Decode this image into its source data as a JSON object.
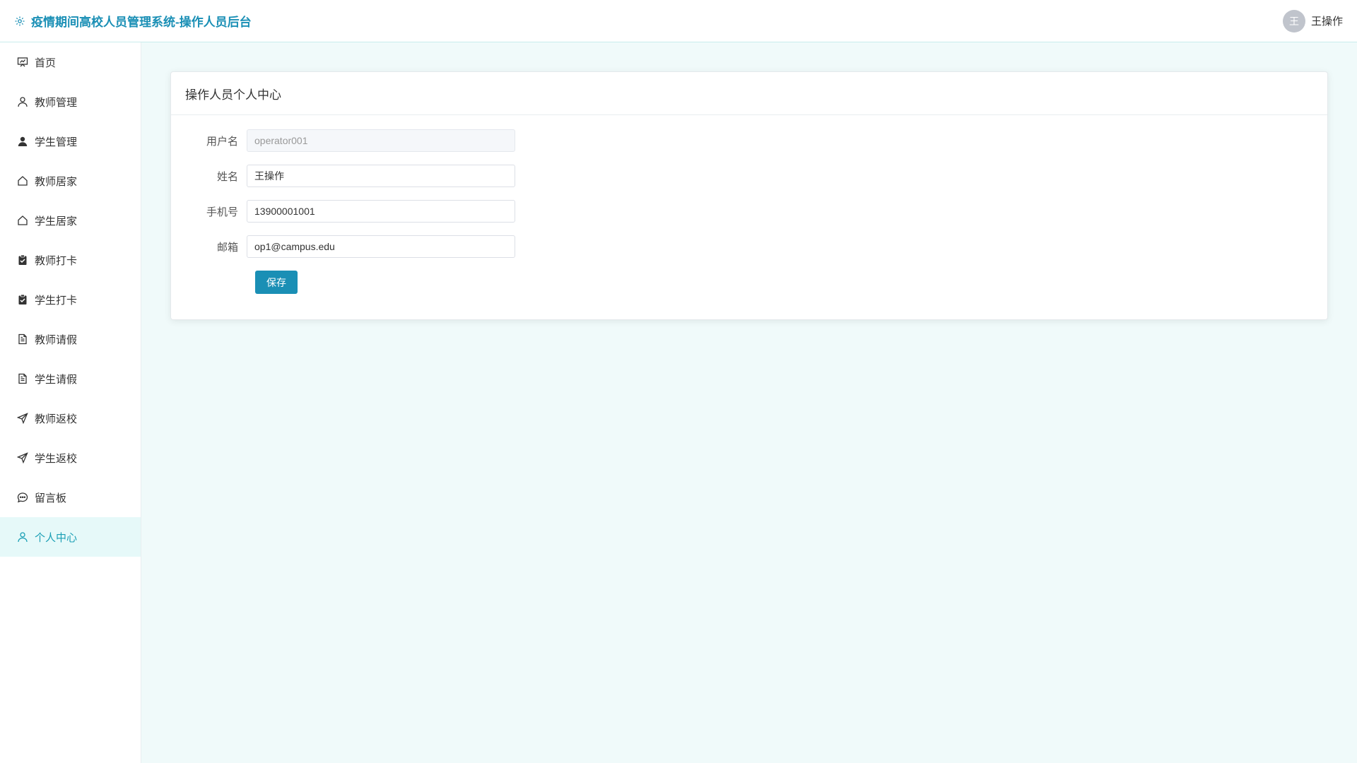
{
  "header": {
    "title": "疫情期间高校人员管理系统-操作人员后台",
    "user_avatar": "王",
    "user_name": "王操作",
    "brand_color": "#1a8fb5"
  },
  "sidebar": {
    "items": [
      {
        "label": "首页",
        "icon": "presentation-icon",
        "active": false
      },
      {
        "label": "教师管理",
        "icon": "user-outline-icon",
        "active": false
      },
      {
        "label": "学生管理",
        "icon": "user-solid-icon",
        "active": false
      },
      {
        "label": "教师居家",
        "icon": "house-icon",
        "active": false
      },
      {
        "label": "学生居家",
        "icon": "house-icon",
        "active": false
      },
      {
        "label": "教师打卡",
        "icon": "clipboard-check-icon",
        "active": false
      },
      {
        "label": "学生打卡",
        "icon": "clipboard-check-icon",
        "active": false
      },
      {
        "label": "教师请假",
        "icon": "document-icon",
        "active": false
      },
      {
        "label": "学生请假",
        "icon": "document-icon",
        "active": false
      },
      {
        "label": "教师返校",
        "icon": "send-icon",
        "active": false
      },
      {
        "label": "学生返校",
        "icon": "send-icon",
        "active": false
      },
      {
        "label": "留言板",
        "icon": "chat-bubble-icon",
        "active": false
      },
      {
        "label": "个人中心",
        "icon": "user-outline-icon",
        "active": true
      }
    ],
    "active_color": "#1a9fb5"
  },
  "main": {
    "card_title": "操作人员个人中心",
    "form": {
      "username_label": "用户名",
      "username_value": "operator001",
      "name_label": "姓名",
      "name_value": "王操作",
      "phone_label": "手机号",
      "phone_value": "13900001001",
      "email_label": "邮箱",
      "email_value": "op1@campus.edu",
      "save_label": "保存"
    }
  }
}
